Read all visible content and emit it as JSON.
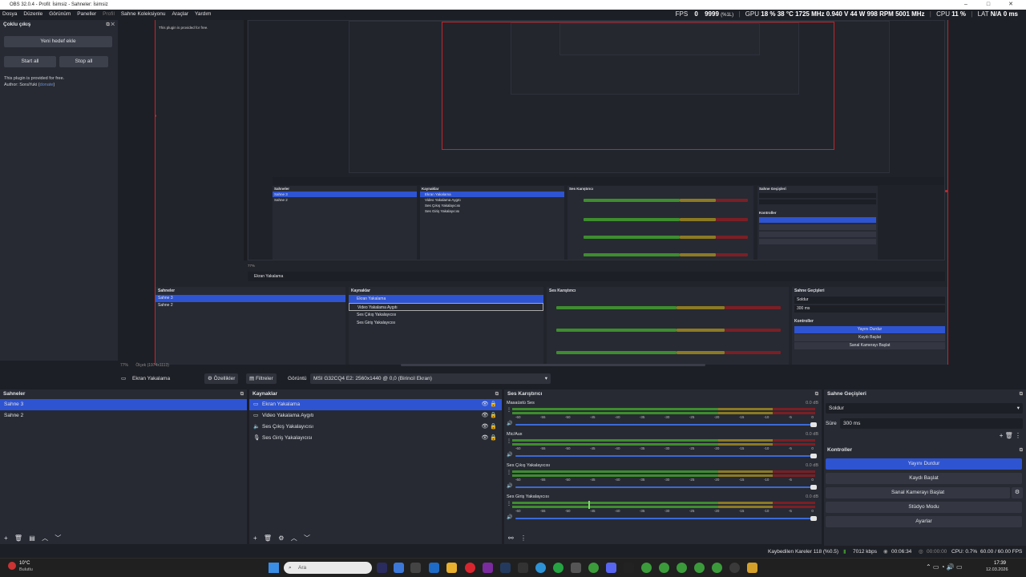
{
  "window": {
    "title": "OBS 32.0.4 - Profil: İsimsiz - Sahneler: İsimsiz",
    "minimize": "–",
    "maximize": "□",
    "close": "✕"
  },
  "menu": [
    "Dosya",
    "Düzenle",
    "Görünüm",
    "Paneller",
    "Profil",
    "Sahne Koleksiyonu",
    "Araçlar",
    "Yardım"
  ],
  "stats": {
    "fps_label": "FPS",
    "fps": "0",
    "fps_low": "9999",
    "fps_low_pct": "(%1L)",
    "gpu_label": "GPU",
    "gpu_load": "18 %",
    "gpu_temp": "38 °C",
    "gpu_clock": "1725 MHz",
    "gpu_volt": "0.940 V",
    "gpu_power": "44 W",
    "gpu_rpm": "998 RPM",
    "gpu_mem": "5001 MHz",
    "cpu_label": "CPU",
    "cpu_load": "11 %",
    "lat_label": "LAT",
    "lat": "N/A",
    "lat_ms": "0 ms"
  },
  "multi_output": {
    "title": "Çoklu çıkış",
    "add_target": "Yeni hedef ekle",
    "start_all": "Start all",
    "stop_all": "Stop all",
    "plugin_note": "This plugin is provided for free.",
    "author_prefix": "Author: SoraYuki (",
    "donate": "donate",
    "author_suffix": ")"
  },
  "preview": {
    "zoom": "77%",
    "canvas_size": "Ölçek (1974x1113)",
    "nested_scenes_title": "Sahneler",
    "nested_sources_title": "Kaynaklar",
    "nested_mixer_title": "Ses Karıştırıcı",
    "nested_transitions_title": "Sahne Geçişleri",
    "nested_controls_title": "Kontroller"
  },
  "source_toolbar": {
    "source_name": "Ekran Yakalama",
    "properties": "Özellikler",
    "filters": "Filtreler",
    "display_label": "Görüntü",
    "display_value": "MSI G32CQ4 E2: 2560x1440 @ 0,0 (Birincil Ekran)"
  },
  "scenes": {
    "title": "Sahneler",
    "items": [
      "Sahne 3",
      "Sahne 2"
    ],
    "selected": 0
  },
  "sources": {
    "title": "Kaynaklar",
    "items": [
      {
        "name": "Ekran Yakalama",
        "icon": "monitor-icon"
      },
      {
        "name": "Video Yakalama Aygıtı",
        "icon": "camera-icon"
      },
      {
        "name": "Ses Çıkış Yakalayıcısı",
        "icon": "speaker-icon"
      },
      {
        "name": "Ses Giriş Yakalayıcısı",
        "icon": "mic-icon"
      }
    ],
    "selected": 0
  },
  "mixer": {
    "title": "Ses Karıştırıcı",
    "ticks": [
      "-60",
      "-55",
      "-50",
      "-45",
      "-40",
      "-35",
      "-30",
      "-25",
      "-20",
      "-15",
      "-10",
      "-5",
      "0"
    ],
    "channels": [
      {
        "name": "Masaüstü Ses",
        "db": "0.0 dB",
        "level": 0
      },
      {
        "name": "Mic/Aux",
        "db": "0.0 dB",
        "level": 0
      },
      {
        "name": "Ses Çıkış Yakalayıcısı",
        "db": "0.0 dB",
        "level": 0
      },
      {
        "name": "Ses Giriş Yakalayıcısı",
        "db": "0.0 dB",
        "level": 0.25
      }
    ]
  },
  "transitions": {
    "title": "Sahne Geçişleri",
    "value": "Soldur",
    "duration_label": "Süre",
    "duration": "300 ms"
  },
  "controls": {
    "title": "Kontroller",
    "stop_stream": "Yayını Durdur",
    "start_record": "Kaydı Başlat",
    "start_vcam": "Sanal Kamerayı Başlat",
    "studio_mode": "Stüdyo Modu",
    "settings": "Ayarlar"
  },
  "statusbar": {
    "dropped": "Kaybedilen Kareler 118 (%0.5)",
    "bitrate": "7012 kbps",
    "stream_time": "00:06:34",
    "record_time": "00:00:00",
    "cpu": "CPU: 0.7%",
    "fps": "60.00 / 60.00 FPS"
  },
  "taskbar": {
    "weather_temp": "10°C",
    "weather_desc": "Bulutlu",
    "search_placeholder": "Ara",
    "time": "17:39",
    "date": "12.03.2026"
  }
}
